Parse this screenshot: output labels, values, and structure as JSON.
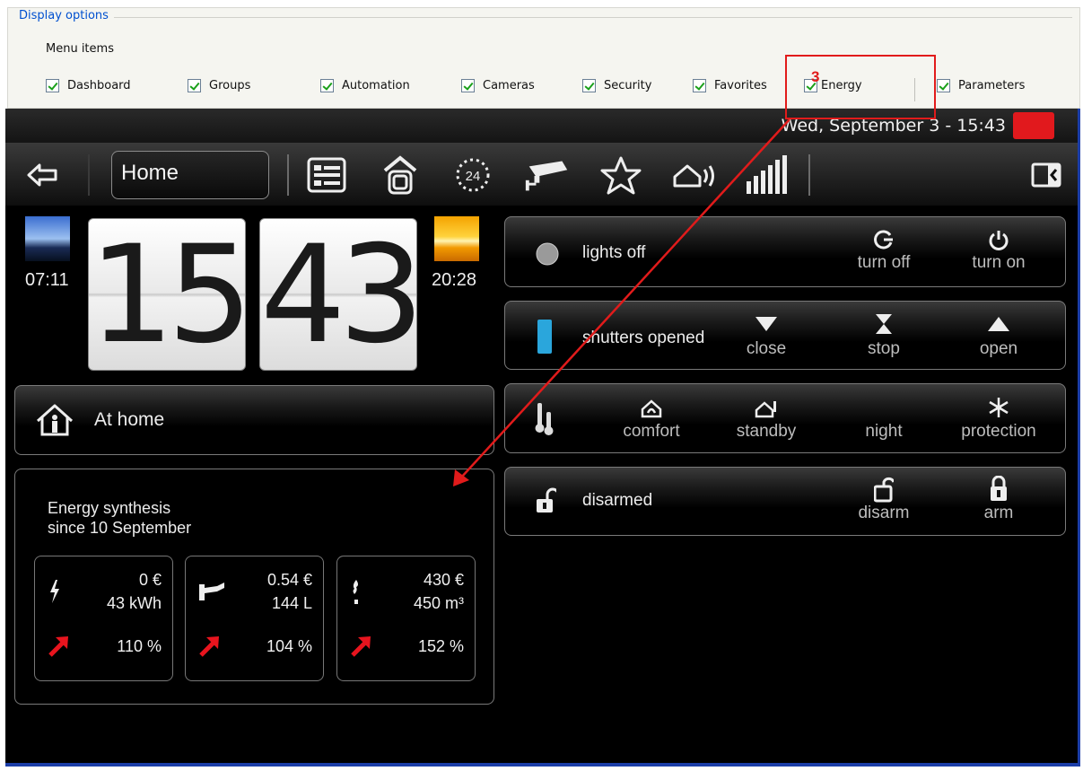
{
  "display_options": {
    "legend": "Display options",
    "menu_items_label": "Menu items",
    "checkboxes": [
      {
        "label": "Dashboard",
        "checked": true
      },
      {
        "label": "Groups",
        "checked": true
      },
      {
        "label": "Automation",
        "checked": true
      },
      {
        "label": "Cameras",
        "checked": true
      },
      {
        "label": "Security",
        "checked": true
      },
      {
        "label": "Favorites",
        "checked": true
      },
      {
        "label": "Energy",
        "checked": true
      },
      {
        "label": "Parameters",
        "checked": true
      }
    ]
  },
  "annotation": {
    "number": "3",
    "color": "#e11b1b"
  },
  "status_bar": {
    "datetime": "Wed, September 3 - 15:43"
  },
  "nav": {
    "home_label": "Home",
    "icons": [
      "back-arrow-icon",
      "dashboard-icon",
      "groups-icon",
      "automation-24-icon",
      "camera-icon",
      "favorites-star-icon",
      "security-icon",
      "energy-bars-icon",
      "exit-icon"
    ]
  },
  "clock": {
    "hours": "15",
    "minutes": "43",
    "sunrise": "07:11",
    "sunset": "20:28"
  },
  "mode": {
    "label": "At home"
  },
  "energy": {
    "title_line1": "Energy synthesis",
    "title_line2": "since 10 September",
    "cards": [
      {
        "icon": "electricity-icon",
        "cost": "0 €",
        "amount": "43 kWh",
        "percent": "110 %"
      },
      {
        "icon": "water-tap-icon",
        "cost": "0.54 €",
        "amount": "144 L",
        "percent": "104 %"
      },
      {
        "icon": "gas-flame-icon",
        "cost": "430 €",
        "amount": "450 m³",
        "percent": "152 %"
      }
    ],
    "trend_color": "#e8141e"
  },
  "lights": {
    "status": "lights off",
    "turn_off": "turn off",
    "turn_on": "turn on"
  },
  "shutters": {
    "status": "shutters opened",
    "close": "close",
    "stop": "stop",
    "open": "open"
  },
  "heating": {
    "comfort": "comfort",
    "standby": "standby",
    "night": "night",
    "protection": "protection"
  },
  "alarm": {
    "status": "disarmed",
    "disarm": "disarm",
    "arm": "arm"
  }
}
